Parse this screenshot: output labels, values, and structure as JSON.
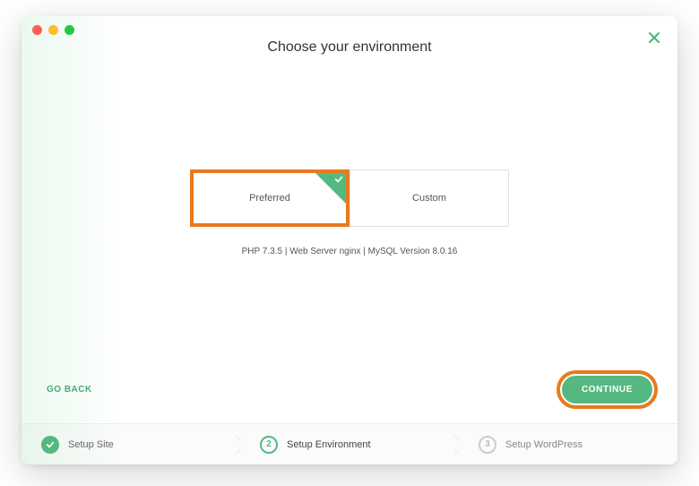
{
  "header": {
    "title": "Choose your environment"
  },
  "options": {
    "preferred": {
      "label": "Preferred"
    },
    "custom": {
      "label": "Custom"
    }
  },
  "env_details": "PHP 7.3.5 | Web Server nginx | MySQL Version 8.0.16",
  "actions": {
    "go_back": "GO BACK",
    "continue": "CONTINUE"
  },
  "stepper": {
    "step1": {
      "label": "Setup Site"
    },
    "step2": {
      "label": "Setup Environment",
      "number": "2"
    },
    "step3": {
      "label": "Setup WordPress",
      "number": "3"
    }
  },
  "colors": {
    "accent_green": "#56b881",
    "highlight_orange": "#e87a1c"
  }
}
